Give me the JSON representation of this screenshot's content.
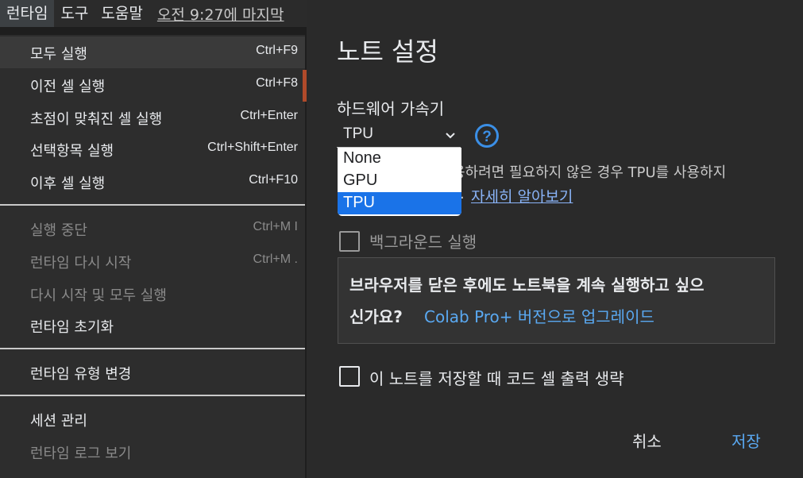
{
  "menubar": {
    "items": [
      "런타임",
      "도구",
      "도움말"
    ],
    "status": "오전 9:27에 마지막"
  },
  "runtime_menu": {
    "items": [
      {
        "label": "모두 실행",
        "shortcut": "Ctrl+F9"
      },
      {
        "label": "이전 셀 실행",
        "shortcut": "Ctrl+F8"
      },
      {
        "label": "초점이 맞춰진 셀 실행",
        "shortcut": "Ctrl+Enter"
      },
      {
        "label": "선택항목 실행",
        "shortcut": "Ctrl+Shift+Enter"
      },
      {
        "label": "이후 셀 실행",
        "shortcut": "Ctrl+F10"
      },
      {
        "label": "실행 중단",
        "shortcut": "Ctrl+M I"
      },
      {
        "label": "런타임 다시 시작",
        "shortcut": "Ctrl+M ."
      },
      {
        "label": "다시 시작 및 모두 실행",
        "shortcut": ""
      },
      {
        "label": "런타임 초기화",
        "shortcut": ""
      },
      {
        "label": "런타임 유형 변경",
        "shortcut": ""
      },
      {
        "label": "세션 관리",
        "shortcut": ""
      },
      {
        "label": "런타임 로그 보기",
        "shortcut": ""
      }
    ]
  },
  "dialog": {
    "title": "노트 설정",
    "hardware_label": "하드웨어 가속기",
    "selected_value": "TPU",
    "options": [
      "None",
      "GPU",
      "TPU"
    ],
    "help_icon": "help-circle-icon",
    "desc_line1": "용하려면 필요하지 않은 경우 TPU를 사용하지",
    "desc_dot": ".",
    "learn_more": "자세히 알아보기",
    "background_label": "백그라운드 실행",
    "promo_line1": "브라우저를 닫은 후에도 노트북을 계속 실행하고 싶으",
    "promo_line2": "신가요?",
    "promo_link": "Colab Pro+ 버전으로 업그레이드",
    "omit_output_label": "이 노트를 저장할 때 코드 셀 출력 생략",
    "cancel_label": "취소",
    "save_label": "저장"
  },
  "colors": {
    "accent": "#1a73e8",
    "link": "#5aa9f2",
    "help_icon": "#3b8fe6"
  }
}
